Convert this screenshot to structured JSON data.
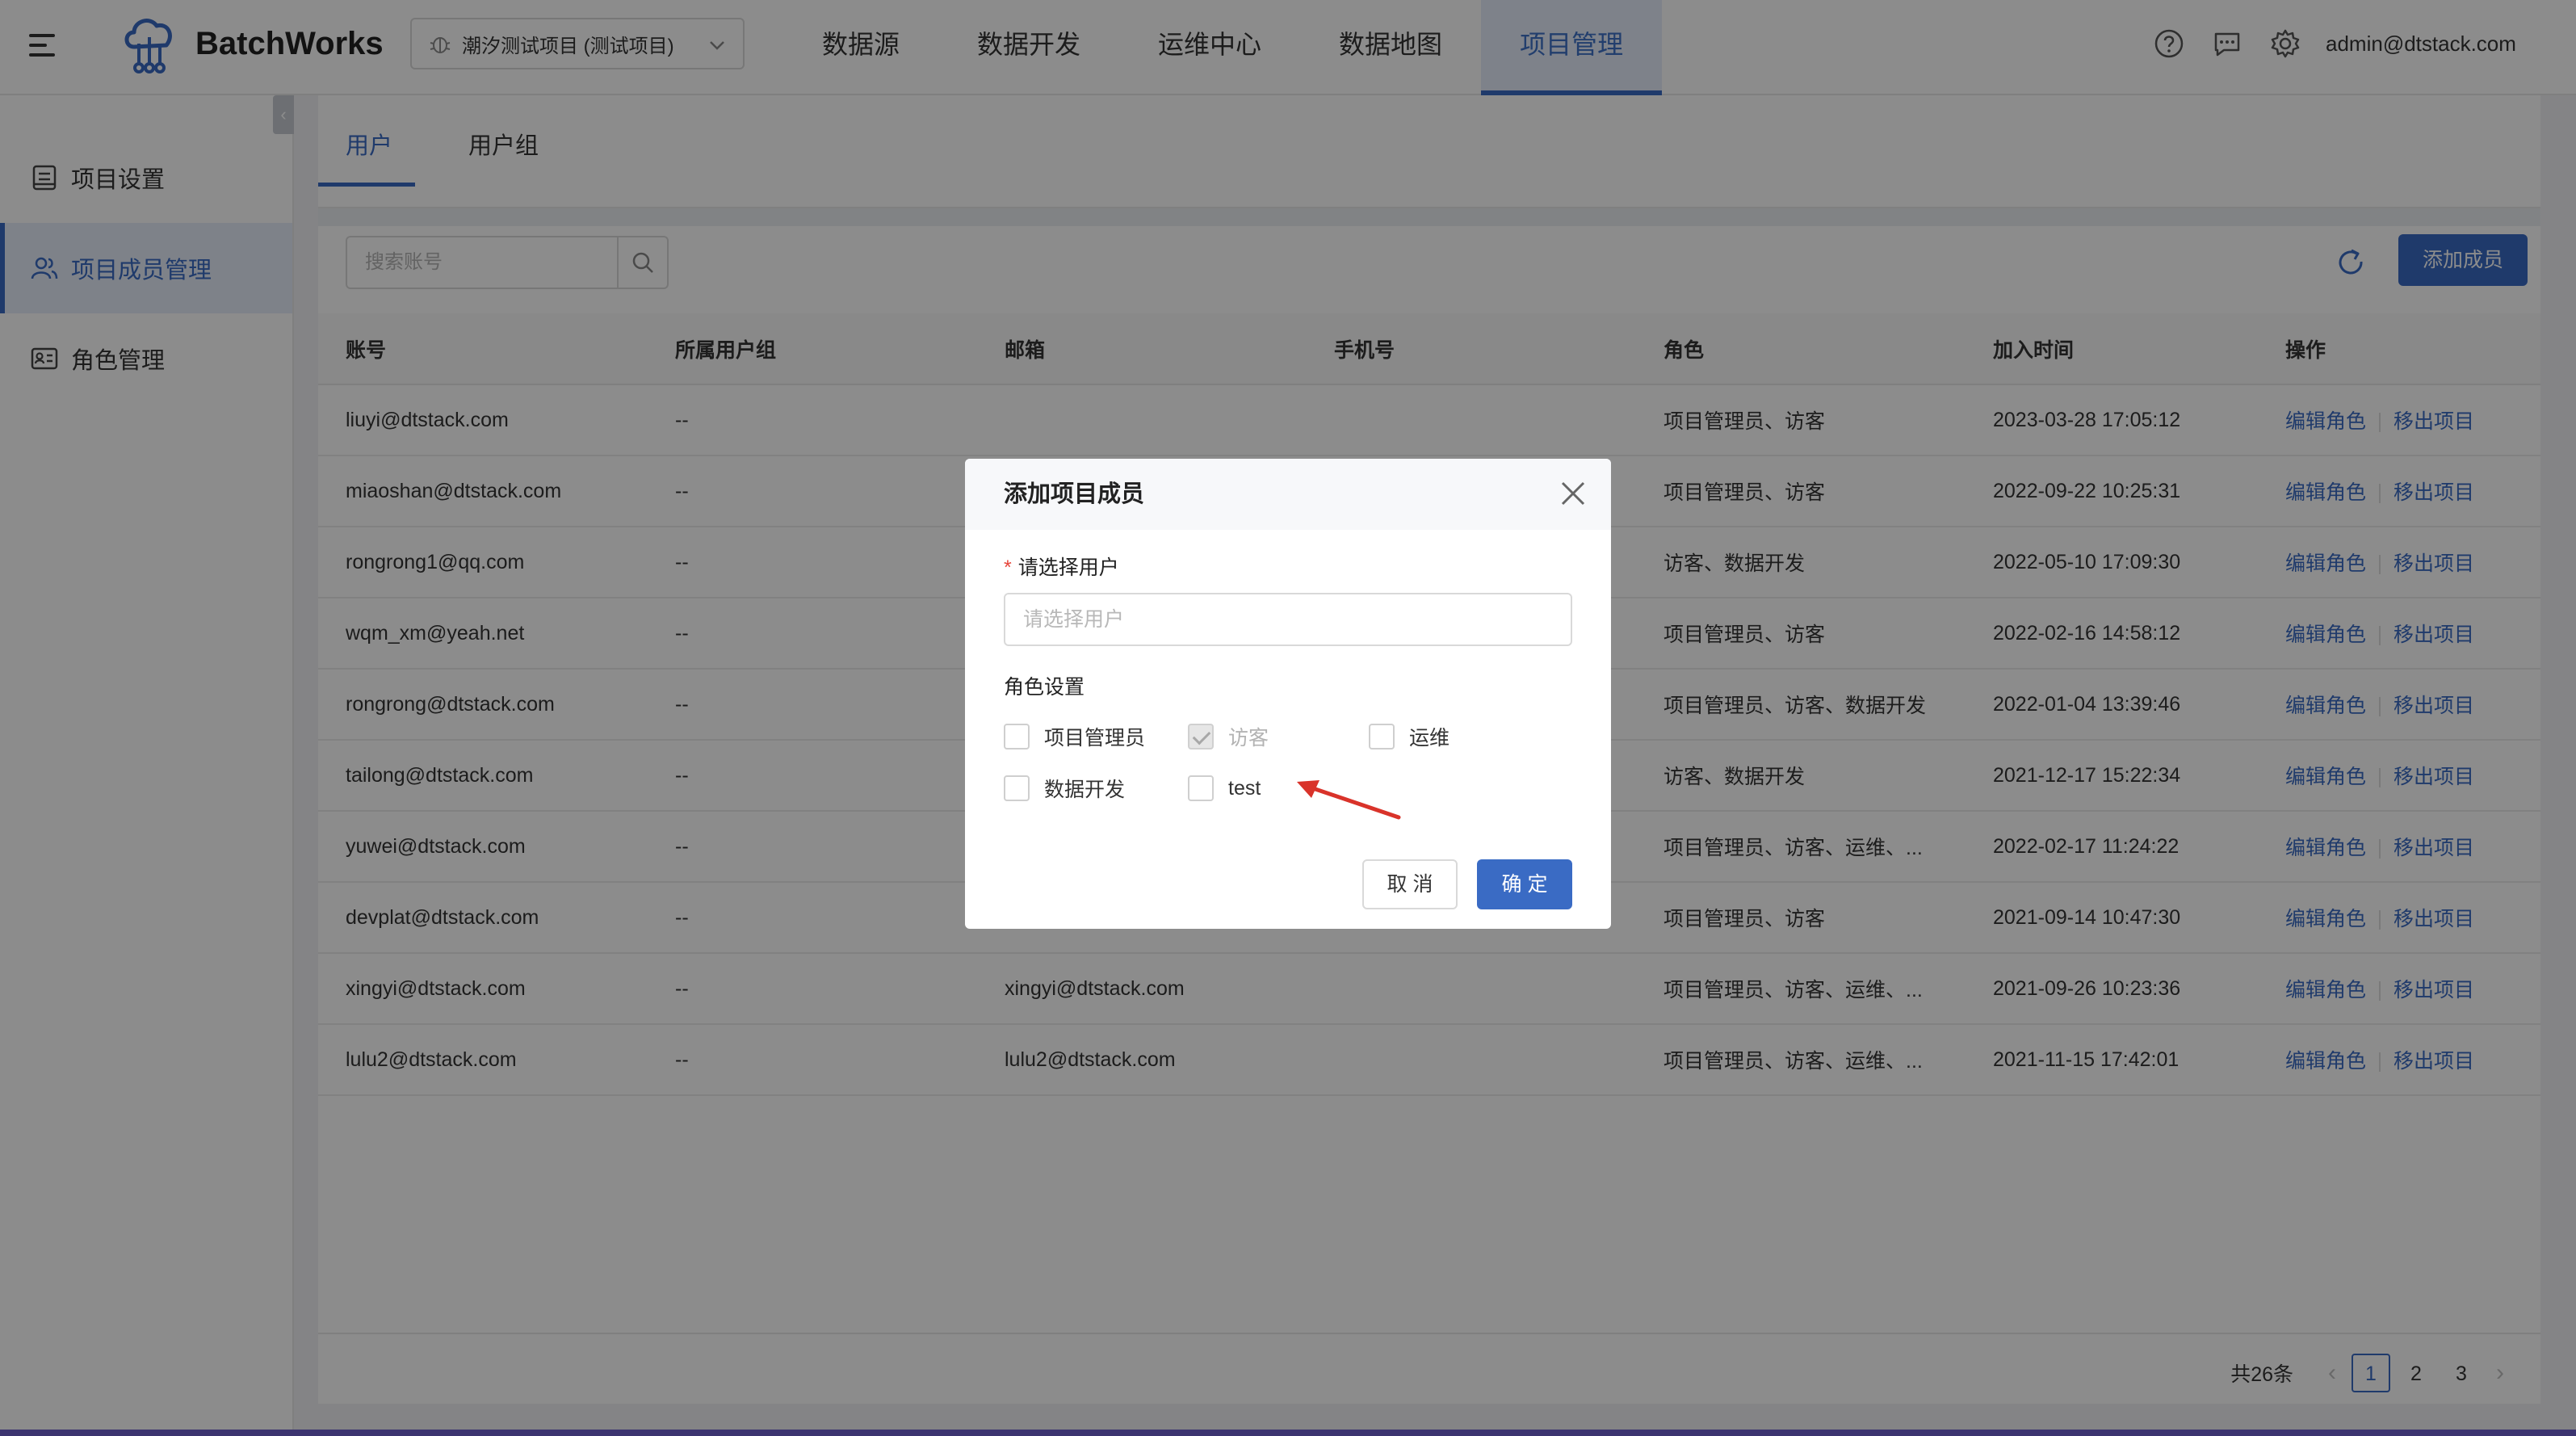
{
  "app": {
    "brand": "BatchWorks",
    "user_email": "admin@dtstack.com"
  },
  "project_select": {
    "value": "潮汐测试项目 (测试项目)"
  },
  "nav": [
    {
      "label": "数据源"
    },
    {
      "label": "数据开发"
    },
    {
      "label": "运维中心"
    },
    {
      "label": "数据地图"
    },
    {
      "label": "项目管理",
      "active": true
    }
  ],
  "sidebar": {
    "items": [
      {
        "label": "项目设置"
      },
      {
        "label": "项目成员管理",
        "active": true
      },
      {
        "label": "角色管理"
      }
    ]
  },
  "tabs": [
    {
      "label": "用户",
      "active": true
    },
    {
      "label": "用户组"
    }
  ],
  "toolbar": {
    "search_placeholder": "搜索账号",
    "add_label": "添加成员"
  },
  "table": {
    "columns": [
      "账号",
      "所属用户组",
      "邮箱",
      "手机号",
      "角色",
      "加入时间",
      "操作"
    ],
    "action_edit": "编辑角色",
    "action_remove": "移出项目",
    "rows": [
      {
        "account": "liuyi@dtstack.com",
        "group": "--",
        "email": "",
        "phone": "",
        "roles": "项目管理员、访客",
        "joined": "2023-03-28 17:05:12"
      },
      {
        "account": "miaoshan@dtstack.com",
        "group": "--",
        "email": "",
        "phone": "",
        "roles": "项目管理员、访客",
        "joined": "2022-09-22 10:25:31"
      },
      {
        "account": "rongrong1@qq.com",
        "group": "--",
        "email": "",
        "phone": "",
        "roles": "访客、数据开发",
        "joined": "2022-05-10 17:09:30"
      },
      {
        "account": "wqm_xm@yeah.net",
        "group": "--",
        "email": "",
        "phone": "",
        "roles": "项目管理员、访客",
        "joined": "2022-02-16 14:58:12"
      },
      {
        "account": "rongrong@dtstack.com",
        "group": "--",
        "email": "",
        "phone": "",
        "roles": "项目管理员、访客、数据开发",
        "joined": "2022-01-04 13:39:46"
      },
      {
        "account": "tailong@dtstack.com",
        "group": "--",
        "email": "",
        "phone": "",
        "roles": "访客、数据开发",
        "joined": "2021-12-17 15:22:34"
      },
      {
        "account": "yuwei@dtstack.com",
        "group": "--",
        "email": "",
        "phone": "",
        "roles": "项目管理员、访客、运维、...",
        "joined": "2022-02-17 11:24:22"
      },
      {
        "account": "devplat@dtstack.com",
        "group": "--",
        "email": "",
        "phone": "",
        "roles": "项目管理员、访客",
        "joined": "2021-09-14 10:47:30"
      },
      {
        "account": "xingyi@dtstack.com",
        "group": "--",
        "email": "xingyi@dtstack.com",
        "phone": "",
        "roles": "项目管理员、访客、运维、...",
        "joined": "2021-09-26 10:23:36"
      },
      {
        "account": "lulu2@dtstack.com",
        "group": "--",
        "email": "lulu2@dtstack.com",
        "phone": "",
        "roles": "项目管理员、访客、运维、...",
        "joined": "2021-11-15 17:42:01"
      }
    ]
  },
  "pagination": {
    "total": "共26条",
    "pages": [
      "1",
      "2",
      "3"
    ],
    "current": "1"
  },
  "modal": {
    "title": "添加项目成员",
    "user_label": "请选择用户",
    "required_mark": "*",
    "user_placeholder": "请选择用户",
    "roles_label": "角色设置",
    "roles": [
      {
        "label": "项目管理员",
        "checked": false,
        "disabled": false
      },
      {
        "label": "访客",
        "checked": true,
        "disabled": true
      },
      {
        "label": "运维",
        "checked": false,
        "disabled": false
      },
      {
        "label": "数据开发",
        "checked": false,
        "disabled": false
      },
      {
        "label": "test",
        "checked": false,
        "disabled": false
      }
    ],
    "cancel_label": "取 消",
    "ok_label": "确 定"
  },
  "colors": {
    "primary": "#3a6bc4",
    "required": "#e6463b",
    "annotation_arrow": "#d9332a",
    "mask": "rgba(0,0,0,0.45)"
  }
}
